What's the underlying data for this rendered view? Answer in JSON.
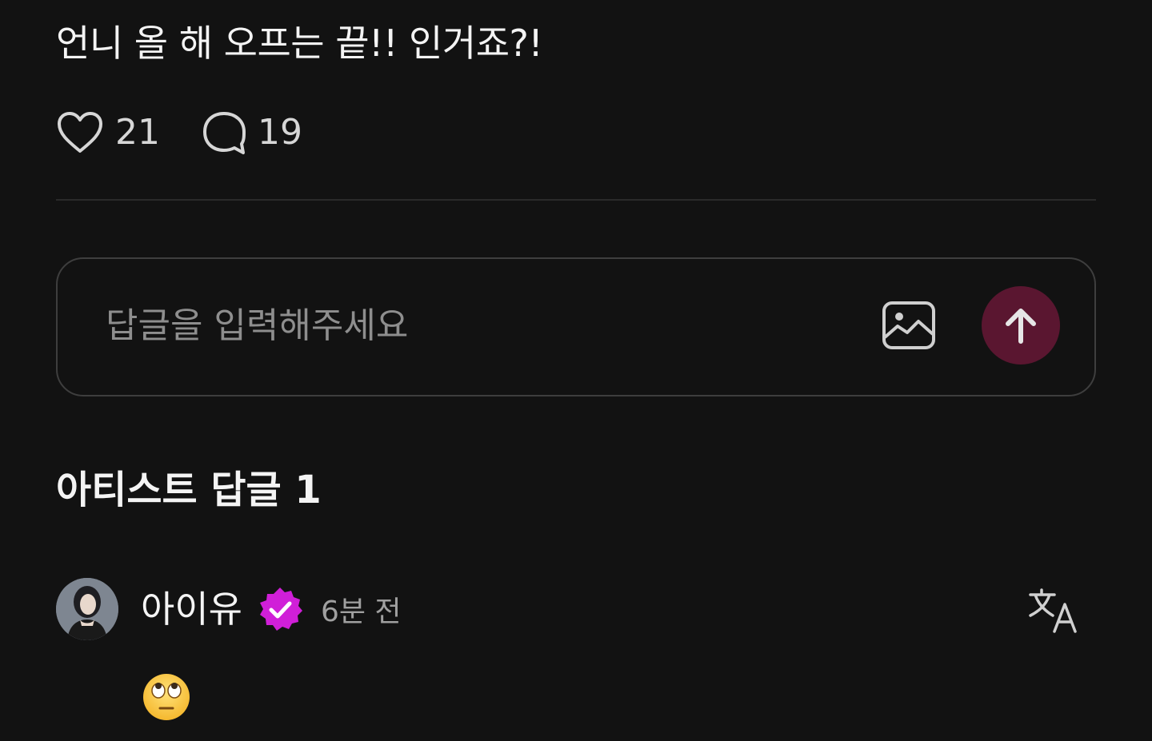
{
  "post": {
    "text": "언니 올 해 오프는 끝!! 인거죠?!",
    "likes": "21",
    "comments": "19"
  },
  "reply": {
    "placeholder": "답글을 입력해주세요",
    "image_icon": "image-icon",
    "send_icon": "arrow-up-icon"
  },
  "artist_replies": {
    "title": "아티스트 답글 1"
  },
  "comment": {
    "author": "아이유",
    "time": "6분 전",
    "body_emoji": "face-with-rolling-eyes",
    "translate_icon": "translate-icon"
  },
  "colors": {
    "background": "#121212",
    "send_button": "#5a1630",
    "verified_badge": "#d01fd8",
    "divider": "#2a2a2a",
    "border": "#3e3e3e"
  }
}
